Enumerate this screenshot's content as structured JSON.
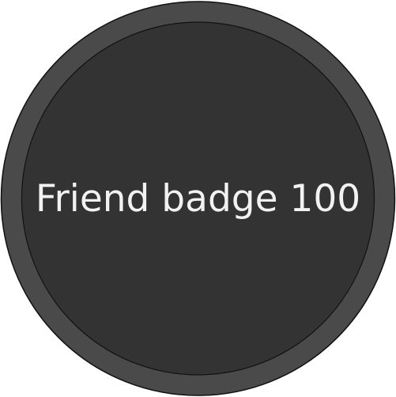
{
  "badge": {
    "label": "Friend badge 100",
    "colors": {
      "outer_ring": "#4a4a4a",
      "inner_disc": "#333333",
      "outline": "#111111",
      "text": "#f2f2f2"
    }
  }
}
